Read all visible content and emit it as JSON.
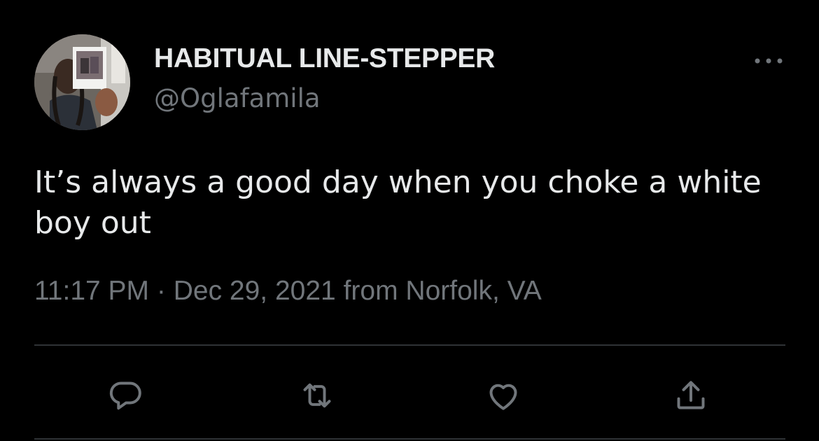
{
  "user": {
    "display_name": "HABITUAL LINE-STEPPER",
    "handle": "@Oglafamila",
    "avatar_icon": "profile-photo"
  },
  "tweet": {
    "text": "It’s always a good day when you choke a white boy out",
    "time": "11:17 PM",
    "separator": "·",
    "date": "Dec 29, 2021",
    "source": "from Norfolk, VA"
  },
  "actions": {
    "reply_icon": "reply-icon",
    "retweet_icon": "retweet-icon",
    "like_icon": "heart-icon",
    "share_icon": "share-icon",
    "more_icon": "more-options-icon"
  },
  "colors": {
    "background": "#000000",
    "primary_text": "#e7e9ea",
    "secondary_text": "#71767b",
    "divider": "#2f3336"
  }
}
